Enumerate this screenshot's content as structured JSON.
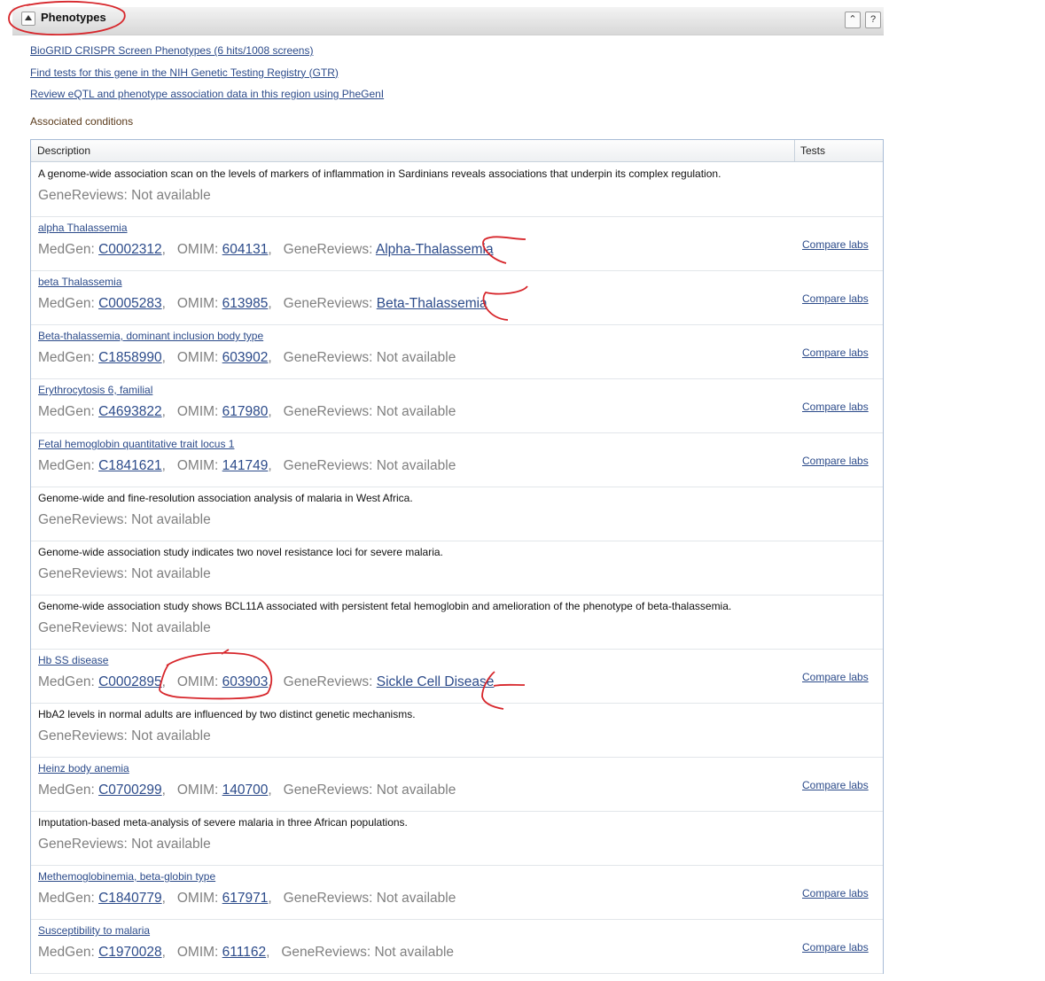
{
  "section": {
    "title": "Phenotypes",
    "collapse_icon": "chevron-double-up-icon",
    "help_icon": "help-icon",
    "help_glyph": "?"
  },
  "top_links": [
    "BioGRID CRISPR Screen Phenotypes (6 hits/1008 screens)",
    "Find tests for this gene in the NIH Genetic Testing Registry (GTR)",
    "Review eQTL and phenotype association data in this region using PheGenI"
  ],
  "associated_label": "Associated conditions",
  "table": {
    "headers": {
      "description": "Description",
      "tests": "Tests"
    },
    "rows": [
      {
        "title": "A genome-wide association scan on the levels of markers of inflammation in Sardinians reveals associations that underpin its complex regulation.",
        "gene_reviews": "Not available"
      },
      {
        "title": "alpha Thalassemia",
        "medgen": "C0002312",
        "omim": "604131",
        "gene_reviews": "Alpha-Thalassemia",
        "tests": "Compare labs"
      },
      {
        "title": "beta Thalassemia",
        "medgen": "C0005283",
        "omim": "613985",
        "gene_reviews": "Beta-Thalassemia",
        "tests": "Compare labs"
      },
      {
        "title": "Beta-thalassemia, dominant inclusion body type",
        "medgen": "C1858990",
        "omim": "603902",
        "gene_reviews": "Not available",
        "tests": "Compare labs"
      },
      {
        "title": "Erythrocytosis 6, familial",
        "medgen": "C4693822",
        "omim": "617980",
        "gene_reviews": "Not available",
        "tests": "Compare labs"
      },
      {
        "title": "Fetal hemoglobin quantitative trait locus 1",
        "medgen": "C1841621",
        "omim": "141749",
        "gene_reviews": "Not available",
        "tests": "Compare labs"
      },
      {
        "title": "Genome-wide and fine-resolution association analysis of malaria in West Africa.",
        "gene_reviews": "Not available"
      },
      {
        "title": "Genome-wide association study indicates two novel resistance loci for severe malaria.",
        "gene_reviews": "Not available"
      },
      {
        "title": "Genome-wide association study shows BCL11A associated with persistent fetal hemoglobin and amelioration of the phenotype of beta-thalassemia.",
        "gene_reviews": "Not available"
      },
      {
        "title": "Hb SS disease",
        "medgen": "C0002895",
        "omim": "603903",
        "gene_reviews": "Sickle Cell Disease",
        "tests": "Compare labs"
      },
      {
        "title": "HbA2 levels in normal adults are influenced by two distinct genetic mechanisms.",
        "gene_reviews": "Not available"
      },
      {
        "title": "Heinz body anemia",
        "medgen": "C0700299",
        "omim": "140700",
        "gene_reviews": "Not available",
        "tests": "Compare labs"
      },
      {
        "title": "Imputation-based meta-analysis of severe malaria in three African populations.",
        "gene_reviews": "Not available"
      },
      {
        "title": "Methemoglobinemia, beta-globin type",
        "medgen": "C1840779",
        "omim": "617971",
        "gene_reviews": "Not available",
        "tests": "Compare labs"
      },
      {
        "title": "Susceptibility to malaria",
        "medgen": "C1970028",
        "omim": "611162",
        "gene_reviews": "Not available",
        "tests": "Compare labs"
      }
    ]
  },
  "labels": {
    "medgen": "MedGen:",
    "omim": "OMIM:",
    "gene_reviews": "GeneReviews:",
    "not_available": "Not available"
  },
  "colors": {
    "link": "#2c4b8a",
    "annotation": "#d7262b"
  }
}
